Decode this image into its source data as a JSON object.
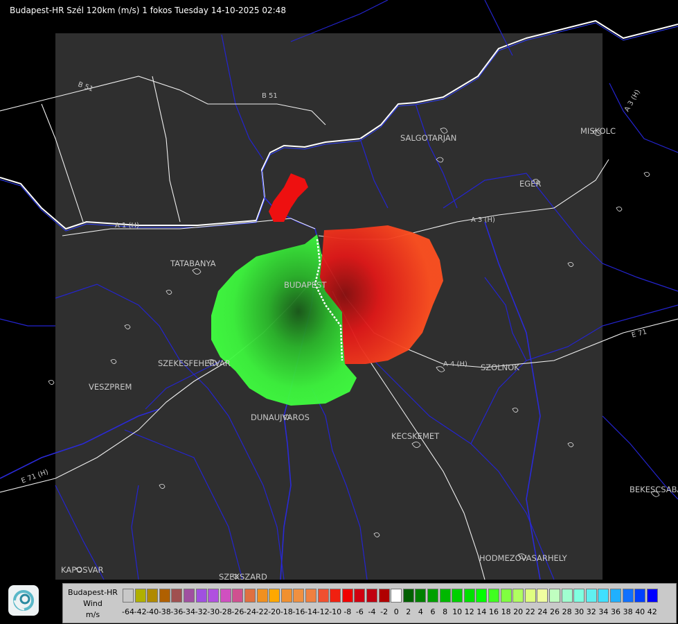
{
  "title": "Budapest-HR Szél 120km (m/s) 1 fokos Tuesday 14-10-2025 02:48",
  "cities": [
    {
      "name": "SALGOTARJAN"
    },
    {
      "name": "MISKOLC"
    },
    {
      "name": "EGER"
    },
    {
      "name": "TATABANYA"
    },
    {
      "name": "BUDAPEST"
    },
    {
      "name": "SZEKESFEHERVAR"
    },
    {
      "name": "VESZPREM"
    },
    {
      "name": "DUNAUJVAROS"
    },
    {
      "name": "KECSKEMET"
    },
    {
      "name": "SZOLNOK"
    },
    {
      "name": "BEKESCSABA"
    },
    {
      "name": "HODMEZOVASARHELY"
    },
    {
      "name": "KAPOSVAR"
    },
    {
      "name": "SZEKSZARD"
    }
  ],
  "roads": [
    {
      "name": "B 51"
    },
    {
      "name": "B 51"
    },
    {
      "name": "A 1 (H)"
    },
    {
      "name": "A 3 (H)"
    },
    {
      "name": "A 3 (H)"
    },
    {
      "name": "A 4 (H)"
    },
    {
      "name": "E 71 (H)"
    },
    {
      "name": "E 71"
    }
  ],
  "legend": {
    "product": "Budapest-HR",
    "quantity": "Wind",
    "unit": "m/s",
    "ticks": [
      "-64",
      "-42",
      "-40",
      "-38",
      "-36",
      "-34",
      "-32",
      "-30",
      "-28",
      "-26",
      "-24",
      "-22",
      "-20",
      "-18",
      "-16",
      "-14",
      "-12",
      "-10",
      "-8",
      "-6",
      "-4",
      "-2",
      "0",
      "2",
      "4",
      "6",
      "8",
      "10",
      "12",
      "14",
      "16",
      "18",
      "20",
      "22",
      "24",
      "26",
      "28",
      "30",
      "32",
      "34",
      "36",
      "38",
      "40",
      "42"
    ],
    "colors": [
      "#c8c8c8",
      "#b0b000",
      "#b08a00",
      "#b06000",
      "#a05050",
      "#a050a0",
      "#a050e0",
      "#b050e0",
      "#d050c0",
      "#d05090",
      "#e07040",
      "#f09020",
      "#ffa800",
      "#f09030",
      "#f09040",
      "#f08040",
      "#f05030",
      "#f02010",
      "#f00000",
      "#d00010",
      "#c00010",
      "#b00000",
      "#ffffff",
      "#006000",
      "#008000",
      "#00a000",
      "#00b800",
      "#00d000",
      "#00e000",
      "#00ff00",
      "#40ff20",
      "#80ff40",
      "#b0ff60",
      "#e0ff80",
      "#f0ffa0",
      "#c0ffc0",
      "#a0ffd0",
      "#80ffe0",
      "#60f0f0",
      "#40e0ff",
      "#20b0ff",
      "#1070ff",
      "#0040ff",
      "#0000ff"
    ]
  },
  "colors": {
    "background": "#000000",
    "radar_area": "#2f2f2f",
    "borders": "#0000ff",
    "rivers": "#2a2ad0",
    "roads": "#ffffff"
  }
}
